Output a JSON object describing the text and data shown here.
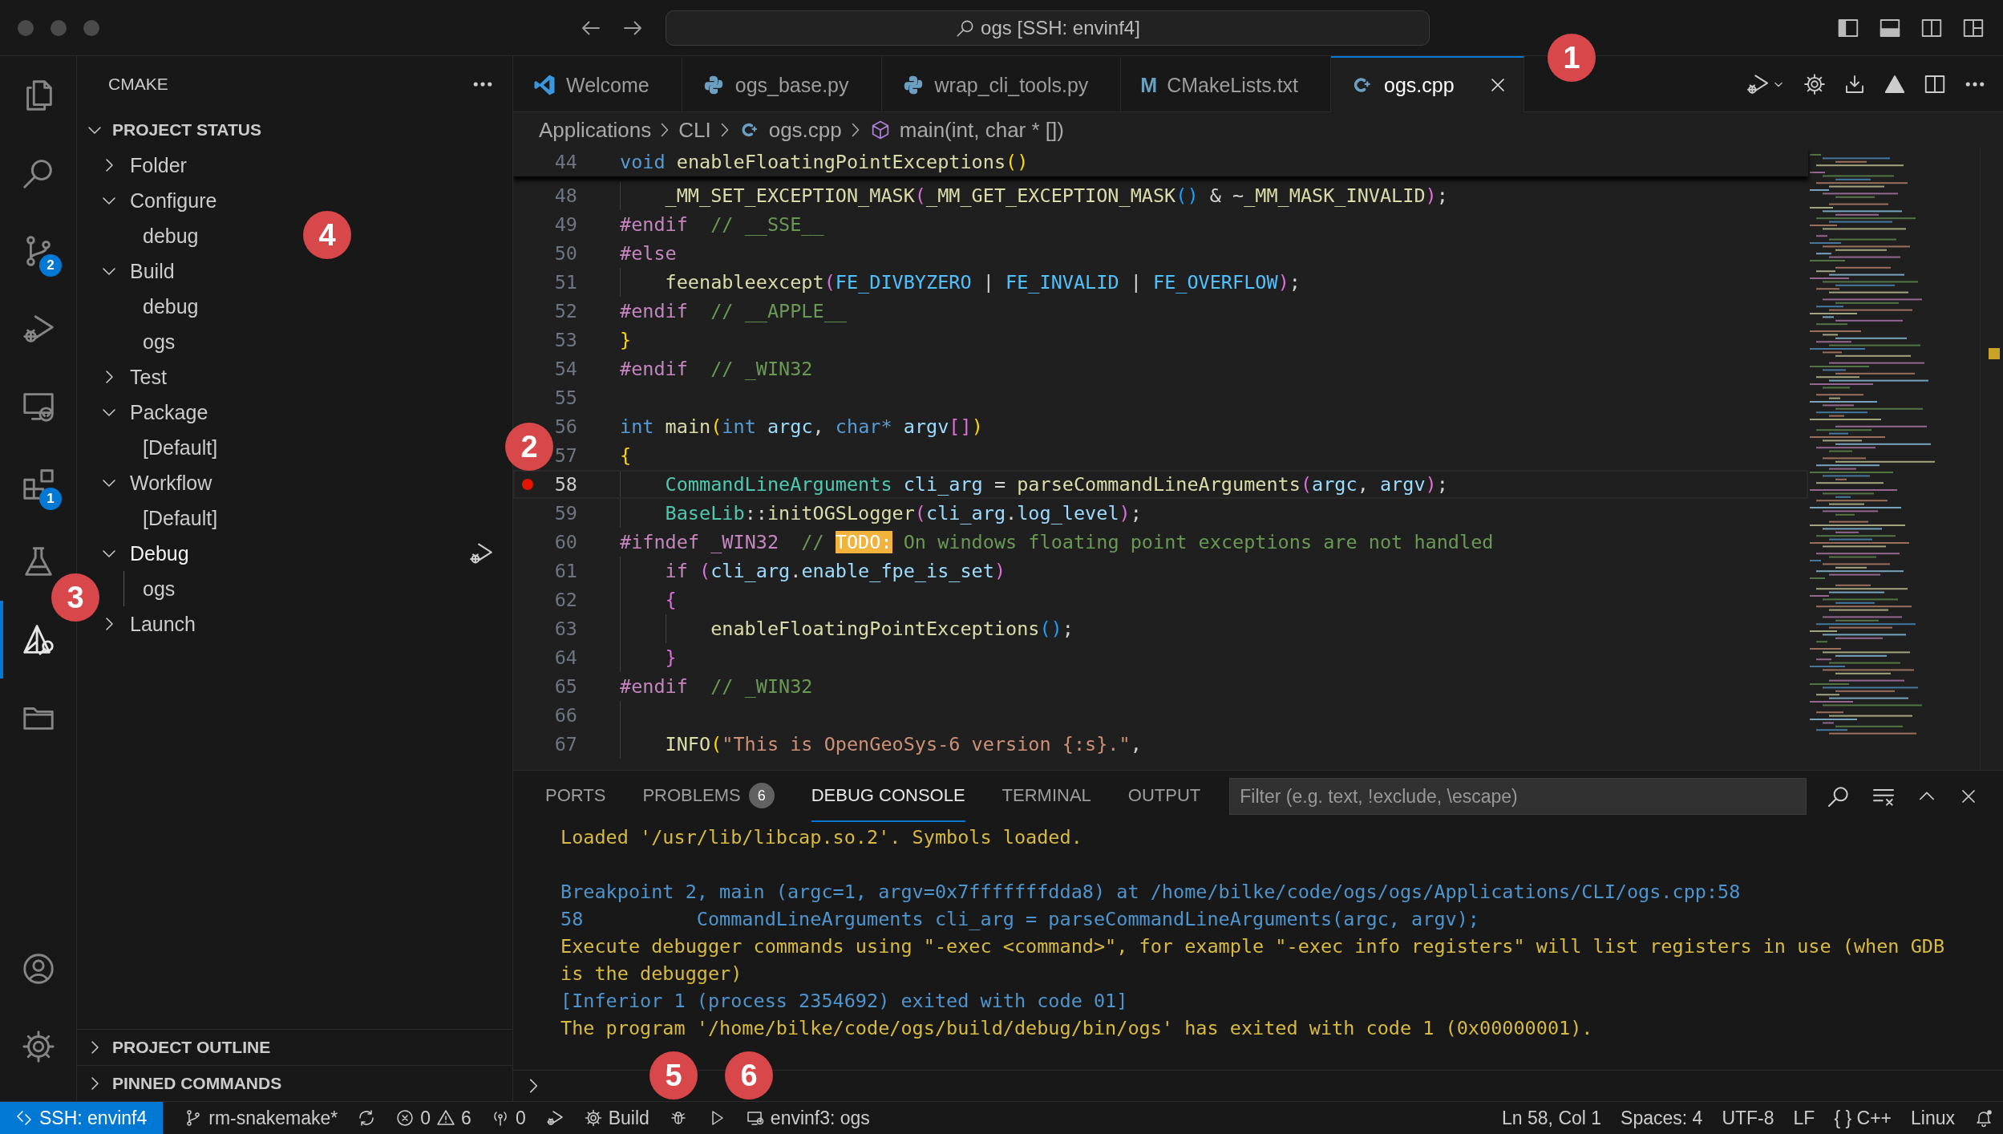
{
  "window": {
    "search": "ogs [SSH: envinf4]"
  },
  "activity_bar": {
    "items": [
      {
        "kind": "files",
        "selected": false
      },
      {
        "kind": "search",
        "selected": false
      },
      {
        "kind": "scm",
        "selected": false,
        "badge": "2"
      },
      {
        "kind": "run-debug",
        "selected": false
      },
      {
        "kind": "remote",
        "selected": false
      },
      {
        "kind": "extensions",
        "selected": false,
        "badge": "1"
      },
      {
        "kind": "testing",
        "selected": false
      },
      {
        "kind": "cmake",
        "selected": true
      },
      {
        "kind": "folder",
        "selected": false
      }
    ],
    "bottom": [
      {
        "kind": "account"
      },
      {
        "kind": "settings"
      }
    ]
  },
  "sidebar": {
    "title": "CMAKE",
    "sections": [
      {
        "title": "PROJECT STATUS",
        "expanded": true,
        "tree": [
          {
            "label": "Folder",
            "expanded": false,
            "hovered": false
          },
          {
            "label": "Configure",
            "expanded": true,
            "hovered": false,
            "children": [
              {
                "label": "debug"
              }
            ]
          },
          {
            "label": "Build",
            "expanded": true,
            "hovered": false,
            "children": [
              {
                "label": "debug"
              },
              {
                "label": "ogs"
              }
            ]
          },
          {
            "label": "Test",
            "expanded": false,
            "hovered": false
          },
          {
            "label": "Package",
            "expanded": true,
            "hovered": false,
            "children": [
              {
                "label": "[Default]"
              }
            ]
          },
          {
            "label": "Workflow",
            "expanded": true,
            "hovered": false,
            "children": [
              {
                "label": "[Default]"
              }
            ]
          },
          {
            "label": "Debug",
            "expanded": true,
            "hovered": true,
            "children": [
              {
                "label": "ogs"
              }
            ]
          },
          {
            "label": "Launch",
            "expanded": false,
            "hovered": false
          }
        ]
      },
      {
        "title": "PROJECT OUTLINE",
        "expanded": false
      },
      {
        "title": "PINNED COMMANDS",
        "expanded": false
      }
    ]
  },
  "tabs": [
    {
      "label": "Welcome",
      "kind": "vscode",
      "selected": false
    },
    {
      "label": "ogs_base.py",
      "kind": "python",
      "selected": false
    },
    {
      "label": "wrap_cli_tools.py",
      "kind": "python",
      "selected": false
    },
    {
      "label": "CMakeLists.txt",
      "kind": "cmake",
      "glyph": "M",
      "selected": false
    },
    {
      "label": "ogs.cpp",
      "kind": "cpp",
      "selected": true
    }
  ],
  "breadcrumbs": [
    {
      "label": "Applications",
      "kind": "folder"
    },
    {
      "label": "CLI",
      "kind": "folder"
    },
    {
      "label": "ogs.cpp",
      "kind": "cpp"
    },
    {
      "label": "main(int, char * [])",
      "kind": "function"
    }
  ],
  "editor": {
    "sticky": {
      "number": "44",
      "tokens": [
        {
          "text": "void",
          "kind": "kw"
        },
        {
          "text": " enableFloatingPointExceptions",
          "kind": "fn"
        },
        {
          "text": "()",
          "kind": "b1"
        }
      ]
    },
    "lines": [
      {
        "number": "48",
        "breakpoint": false,
        "current": false,
        "tokens": [
          {
            "kind": "indent"
          },
          {
            "text": "_MM_SET_EXCEPTION_MASK",
            "kind": "fn"
          },
          {
            "text": "(",
            "kind": "b2"
          },
          {
            "text": "_MM_GET_EXCEPTION_MASK",
            "kind": "fn"
          },
          {
            "text": "()",
            "kind": "b3"
          },
          {
            "text": " & ~",
            "kind": "plain"
          },
          {
            "text": "_MM_MASK_INVALID",
            "kind": "fn"
          },
          {
            "text": ")",
            "kind": "b2"
          },
          {
            "text": ";",
            "kind": "plain"
          }
        ]
      },
      {
        "number": "49",
        "breakpoint": false,
        "current": false,
        "tokens": [
          {
            "text": "#endif",
            "kind": "pre"
          },
          {
            "text": "  // __SSE__",
            "kind": "cmt"
          }
        ]
      },
      {
        "number": "50",
        "breakpoint": false,
        "current": false,
        "tokens": [
          {
            "text": "#else",
            "kind": "pre"
          }
        ]
      },
      {
        "number": "51",
        "breakpoint": false,
        "current": false,
        "tokens": [
          {
            "kind": "indent"
          },
          {
            "text": "feenableexcept",
            "kind": "fn"
          },
          {
            "text": "(",
            "kind": "b2"
          },
          {
            "text": "FE_DIVBYZERO",
            "kind": "const"
          },
          {
            "text": " | ",
            "kind": "plain"
          },
          {
            "text": "FE_INVALID",
            "kind": "const"
          },
          {
            "text": " | ",
            "kind": "plain"
          },
          {
            "text": "FE_OVERFLOW",
            "kind": "const"
          },
          {
            "text": ")",
            "kind": "b2"
          },
          {
            "text": ";",
            "kind": "plain"
          }
        ]
      },
      {
        "number": "52",
        "breakpoint": false,
        "current": false,
        "tokens": [
          {
            "text": "#endif",
            "kind": "pre"
          },
          {
            "text": "  // __APPLE__",
            "kind": "cmt"
          }
        ]
      },
      {
        "number": "53",
        "breakpoint": false,
        "current": false,
        "tokens": [
          {
            "text": "}",
            "kind": "b1"
          }
        ]
      },
      {
        "number": "54",
        "breakpoint": false,
        "current": false,
        "tokens": [
          {
            "text": "#endif",
            "kind": "pre"
          },
          {
            "text": "  // _WIN32",
            "kind": "cmt"
          }
        ]
      },
      {
        "number": "55",
        "breakpoint": false,
        "current": false
      },
      {
        "number": "56",
        "breakpoint": false,
        "current": false,
        "tokens": [
          {
            "text": "int",
            "kind": "kw"
          },
          {
            "text": " main",
            "kind": "fn"
          },
          {
            "text": "(",
            "kind": "b1"
          },
          {
            "text": "int",
            "kind": "kw"
          },
          {
            "text": " argc",
            "kind": "var"
          },
          {
            "text": ", ",
            "kind": "plain"
          },
          {
            "text": "char*",
            "kind": "kw"
          },
          {
            "text": " argv",
            "kind": "var"
          },
          {
            "text": "[]",
            "kind": "b2"
          },
          {
            "text": ")",
            "kind": "b1"
          }
        ]
      },
      {
        "number": "57",
        "breakpoint": false,
        "current": false,
        "tokens": [
          {
            "text": "{",
            "kind": "b1"
          }
        ]
      },
      {
        "number": "58",
        "breakpoint": true,
        "current": true,
        "tokens": [
          {
            "kind": "indent"
          },
          {
            "text": "CommandLineArguments",
            "kind": "type"
          },
          {
            "text": " cli_arg",
            "kind": "var"
          },
          {
            "text": " = ",
            "kind": "plain"
          },
          {
            "text": "parseCommandLineArguments",
            "kind": "fn"
          },
          {
            "text": "(",
            "kind": "b2"
          },
          {
            "text": "argc",
            "kind": "var"
          },
          {
            "text": ", ",
            "kind": "plain"
          },
          {
            "text": "argv",
            "kind": "var"
          },
          {
            "text": ")",
            "kind": "b2"
          },
          {
            "text": ";",
            "kind": "plain"
          }
        ]
      },
      {
        "number": "59",
        "breakpoint": false,
        "current": false,
        "tokens": [
          {
            "kind": "indent"
          },
          {
            "text": "BaseLib",
            "kind": "type"
          },
          {
            "text": "::",
            "kind": "plain"
          },
          {
            "text": "initOGSLogger",
            "kind": "fn"
          },
          {
            "text": "(",
            "kind": "b2"
          },
          {
            "text": "cli_arg",
            "kind": "var"
          },
          {
            "text": ".",
            "kind": "plain"
          },
          {
            "text": "log_level",
            "kind": "var"
          },
          {
            "text": ")",
            "kind": "b2"
          },
          {
            "text": ";",
            "kind": "plain"
          }
        ]
      },
      {
        "number": "60",
        "breakpoint": false,
        "current": false,
        "tokens": [
          {
            "text": "#ifndef _WIN32",
            "kind": "pre"
          },
          {
            "text": "  // ",
            "kind": "cmt"
          },
          {
            "text": "TODO:",
            "kind": "todo"
          },
          {
            "text": " On windows floating point exceptions are not handled",
            "kind": "cmt"
          }
        ]
      },
      {
        "number": "61",
        "breakpoint": false,
        "current": false,
        "tokens": [
          {
            "kind": "indent"
          },
          {
            "text": "if",
            "kind": "ctrl"
          },
          {
            "text": " (",
            "kind": "b2"
          },
          {
            "text": "cli_arg",
            "kind": "var"
          },
          {
            "text": ".",
            "kind": "plain"
          },
          {
            "text": "enable_fpe_is_set",
            "kind": "var"
          },
          {
            "text": ")",
            "kind": "b2"
          }
        ]
      },
      {
        "number": "62",
        "breakpoint": false,
        "current": false,
        "tokens": [
          {
            "kind": "indent"
          },
          {
            "text": "{",
            "kind": "b2"
          }
        ]
      },
      {
        "number": "63",
        "breakpoint": false,
        "current": false,
        "tokens": [
          {
            "kind": "indent"
          },
          {
            "kind": "indent"
          },
          {
            "text": "enableFloatingPointExceptions",
            "kind": "fn"
          },
          {
            "text": "()",
            "kind": "b3"
          },
          {
            "text": ";",
            "kind": "plain"
          }
        ]
      },
      {
        "number": "64",
        "breakpoint": false,
        "current": false,
        "tokens": [
          {
            "kind": "indent"
          },
          {
            "text": "}",
            "kind": "b2"
          }
        ]
      },
      {
        "number": "65",
        "breakpoint": false,
        "current": false,
        "tokens": [
          {
            "text": "#endif",
            "kind": "pre"
          },
          {
            "text": "  // _WIN32",
            "kind": "cmt"
          }
        ]
      },
      {
        "number": "66",
        "breakpoint": false,
        "current": false,
        "tokens": [
          {
            "kind": "indent"
          }
        ]
      },
      {
        "number": "67",
        "breakpoint": false,
        "current": false,
        "tokens": [
          {
            "kind": "indent"
          },
          {
            "text": "INFO",
            "kind": "fn"
          },
          {
            "text": "(",
            "kind": "b1"
          },
          {
            "text": "\"This is OpenGeoSys-6 version {:s}.\"",
            "kind": "str"
          },
          {
            "text": ",",
            "kind": "plain"
          }
        ]
      }
    ]
  },
  "panel": {
    "tabs": [
      {
        "label": "PORTS",
        "selected": false
      },
      {
        "label": "PROBLEMS",
        "badge": "6",
        "selected": false
      },
      {
        "label": "DEBUG CONSOLE",
        "selected": true
      },
      {
        "label": "TERMINAL",
        "selected": false
      },
      {
        "label": "OUTPUT",
        "selected": false
      }
    ],
    "filter": {
      "placeholder": "Filter (e.g. text, !exclude, \\escape)"
    },
    "console": [
      {
        "kind": "output",
        "text": "Loaded '/usr/lib/libcap.so.2'. Symbols loaded."
      },
      {
        "kind": "gap"
      },
      {
        "kind": "debugger",
        "text": "Breakpoint 2, main (argc=1, argv=0x7fffffffdda8) at /home/bilke/code/ogs/ogs/Applications/CLI/ogs.cpp:58"
      },
      {
        "kind": "debugger",
        "text": "58          CommandLineArguments cli_arg = parseCommandLineArguments(argc, argv);"
      },
      {
        "kind": "output",
        "text": "Execute debugger commands using \"-exec <command>\", for example \"-exec info registers\" will list registers in use (when GDB is the debugger)"
      },
      {
        "kind": "debugger",
        "text": "[Inferior 1 (process 2354692) exited with code 01]"
      },
      {
        "kind": "output",
        "text": "The program '/home/bilke/code/ogs/build/debug/bin/ogs' has exited with code 1 (0x00000001)."
      }
    ]
  },
  "status_bar": {
    "left": [
      {
        "kind": "remote",
        "text": "SSH: envinf4"
      },
      {
        "kind": "branch",
        "text": "rm-snakemake*"
      },
      {
        "kind": "sync"
      },
      {
        "kind": "problems",
        "errors": "0",
        "warnings": "6"
      },
      {
        "kind": "ports",
        "text": "0"
      },
      {
        "kind": "debug-run"
      },
      {
        "kind": "build",
        "text": "Build"
      },
      {
        "kind": "bug"
      },
      {
        "kind": "play"
      },
      {
        "kind": "target",
        "text": "envinf3: ogs"
      }
    ],
    "right": [
      {
        "kind": "text",
        "text": "Ln 58, Col 1"
      },
      {
        "kind": "text",
        "text": "Spaces: 4"
      },
      {
        "kind": "text",
        "text": "UTF-8"
      },
      {
        "kind": "text",
        "text": "LF"
      },
      {
        "kind": "language",
        "glyph": "{ }",
        "text": "C++"
      },
      {
        "kind": "text",
        "text": "Linux"
      },
      {
        "kind": "bell"
      }
    ]
  },
  "annotations": [
    {
      "number": "1"
    },
    {
      "number": "2"
    },
    {
      "number": "3"
    },
    {
      "number": "4"
    },
    {
      "number": "5"
    },
    {
      "number": "6"
    }
  ]
}
